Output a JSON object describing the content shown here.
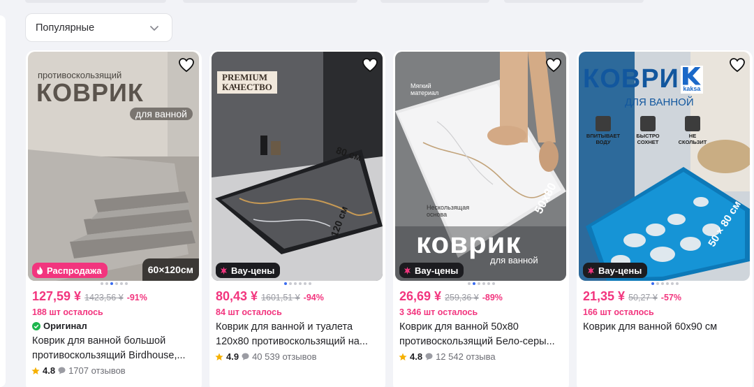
{
  "sort": {
    "label": "Популярные"
  },
  "colors": {
    "accent": "#f2357e",
    "dark_badge": "#1c1c20",
    "dot_active": "#3b6cf0"
  },
  "cards": [
    {
      "image": {
        "line1": "противоскользящий",
        "line2": "КОВРИК",
        "line3": "для ванной",
        "size_label": "60×120см"
      },
      "badge": "Распродажа",
      "price": "127,59 ¥",
      "old_price": "1423,56 ¥",
      "discount": "-91%",
      "left": "188 шт осталось",
      "original": "Оригинал",
      "title_line1": "Коврик для ванной большой",
      "title_line2": "противоскользящий Birdhouse,...",
      "rating": "4.8",
      "reviews": "1707 отзывов"
    },
    {
      "image": {
        "premium1": "PREMIUM",
        "premium2": "КАЧЕСТВО",
        "dim1": "80 см",
        "dim2": "120 см"
      },
      "badge": "Вау-цены",
      "price": "80,43 ¥",
      "old_price": "1601,51 ¥",
      "discount": "-94%",
      "left": "84 шт осталось",
      "title_line1": "Коврик для ванной и туалета",
      "title_line2": "120x80 противоскользящий на...",
      "rating": "4.9",
      "reviews": "40 539 отзывов"
    },
    {
      "image": {
        "label1a": "Мягкий",
        "label1b": "материал",
        "label2a": "Нескользящая",
        "label2b": "основа",
        "size": "50х80",
        "big": "коврик",
        "sub": "для ванной"
      },
      "badge": "Вау-цены",
      "price": "26,69 ¥",
      "old_price": "259,36 ¥",
      "discount": "-89%",
      "left": "3 346 шт осталось",
      "title_line1": "Коврик для ванной 50х80",
      "title_line2": "противоскользящий Бело-серы...",
      "rating": "4.8",
      "reviews": "12 542 отзыва"
    },
    {
      "image": {
        "big": "КОВРИ",
        "brand": "kaksa",
        "sub": "ДЛЯ ВАННОЙ",
        "f1a": "ВПИТЫВАЕТ",
        "f1b": "ВОДУ",
        "f2a": "БЫСТРО",
        "f2b": "СОХНЕТ",
        "f3a": "НЕ",
        "f3b": "СКОЛЬЗИТ",
        "size": "50 × 80 см"
      },
      "badge": "Вау-цены",
      "price": "21,35 ¥",
      "old_price": "50,27 ¥",
      "discount": "-57%",
      "left": "166 шт осталось",
      "title_line1": "Коврик для ванной 60х90 см"
    }
  ]
}
